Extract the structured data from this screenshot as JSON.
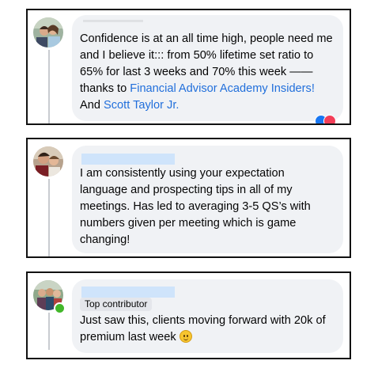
{
  "comments": [
    {
      "text_parts": [
        "Confidence is at an all time high, people need me and I believe it::: from 50% lifetime set ratio to 65% for last 3 weeks  and 70% this week —— thanks to ",
        "Financial Advisor Academy Insiders!",
        "\nAnd ",
        "Scott Taylor Jr."
      ],
      "reactions": [
        "like-icon",
        "love-icon"
      ],
      "colors": {
        "link": "#216fdb",
        "bubble": "#f0f2f5"
      }
    },
    {
      "text": "I am consistently using your expectation language and prospecting tips in all of my meetings. Has led to averaging 3-5 QS’s with numbers given per meeting which is game changing!",
      "colors": {
        "redacted_name": "#cfe4fb"
      }
    },
    {
      "badge": "Top contributor",
      "text": "Just saw this, clients moving forward with 20k of premium last week",
      "emoji": "slightly-smiling-face-icon",
      "status": "online",
      "colors": {
        "online": "#42b72a"
      }
    }
  ]
}
